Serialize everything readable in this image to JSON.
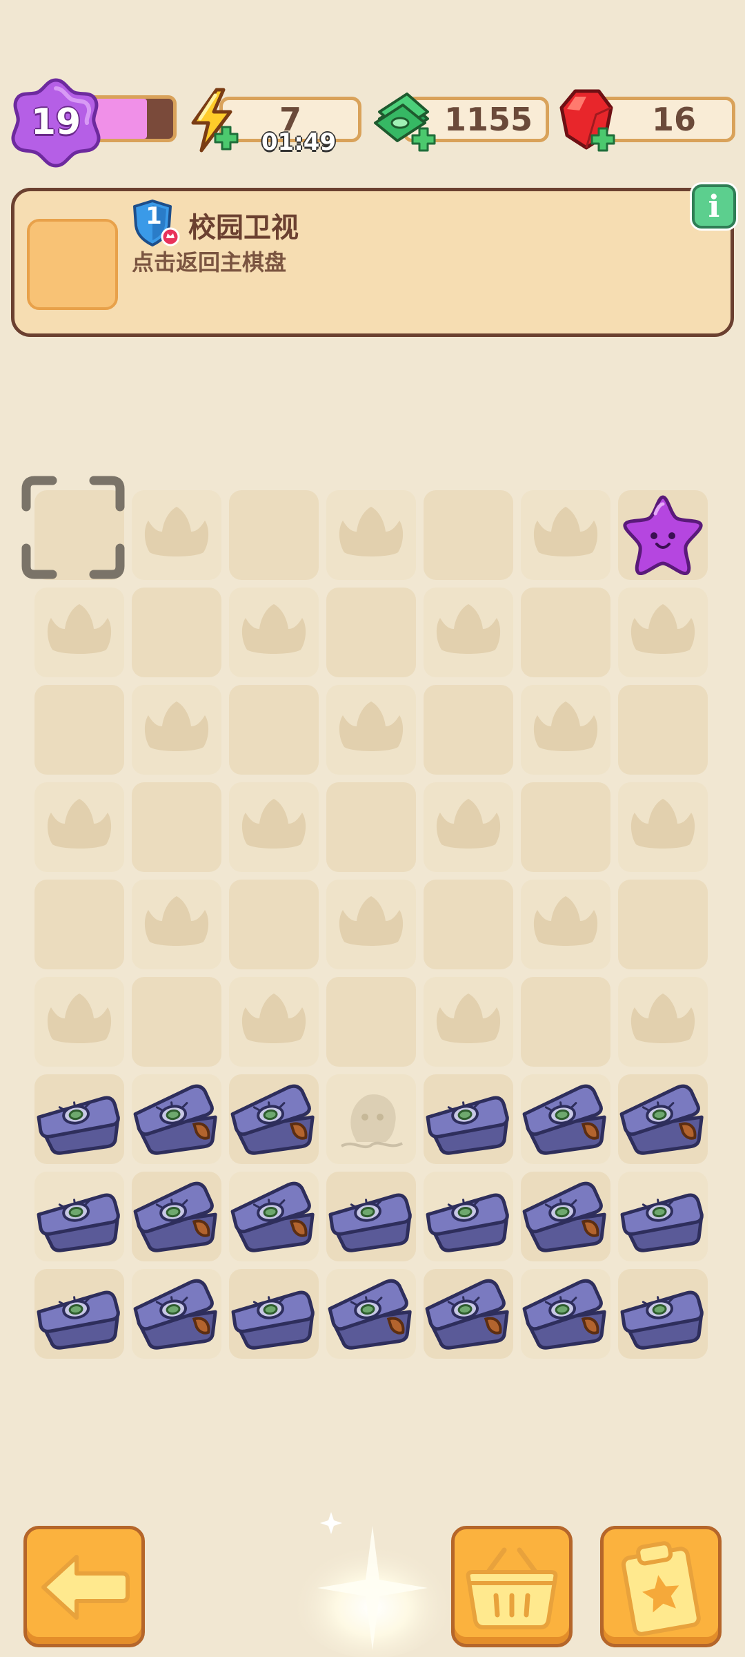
{
  "header": {
    "level": "19",
    "xp_fraction": 0.72,
    "energy": {
      "value": "7",
      "timer": "01:49",
      "icon": "lightning-icon"
    },
    "cash": {
      "value": "1155",
      "icon": "cash-stack-icon"
    },
    "gems": {
      "value": "16",
      "icon": "ruby-gem-icon"
    }
  },
  "task": {
    "badge_number": "1",
    "title": "校园卫视",
    "subtitle": "点击返回主棋盘",
    "info_label": "i"
  },
  "board": {
    "columns": 7,
    "rows": 9,
    "top_right_item": "purple-star-jelly-icon",
    "chest_rows": [
      [
        "chest",
        "chest-open",
        "chest-open",
        "ghost",
        "chest",
        "chest-open",
        "chest-open"
      ],
      [
        "chest",
        "chest-open",
        "chest-open",
        "chest",
        "chest",
        "chest-open",
        "chest"
      ],
      [
        "chest",
        "chest-open",
        "chest",
        "chest-open",
        "chest-open",
        "chest-open",
        "chest"
      ]
    ]
  },
  "buttons": {
    "back": "back-arrow-icon",
    "basket": "basket-icon",
    "tasks": "clipboard-star-icon"
  }
}
